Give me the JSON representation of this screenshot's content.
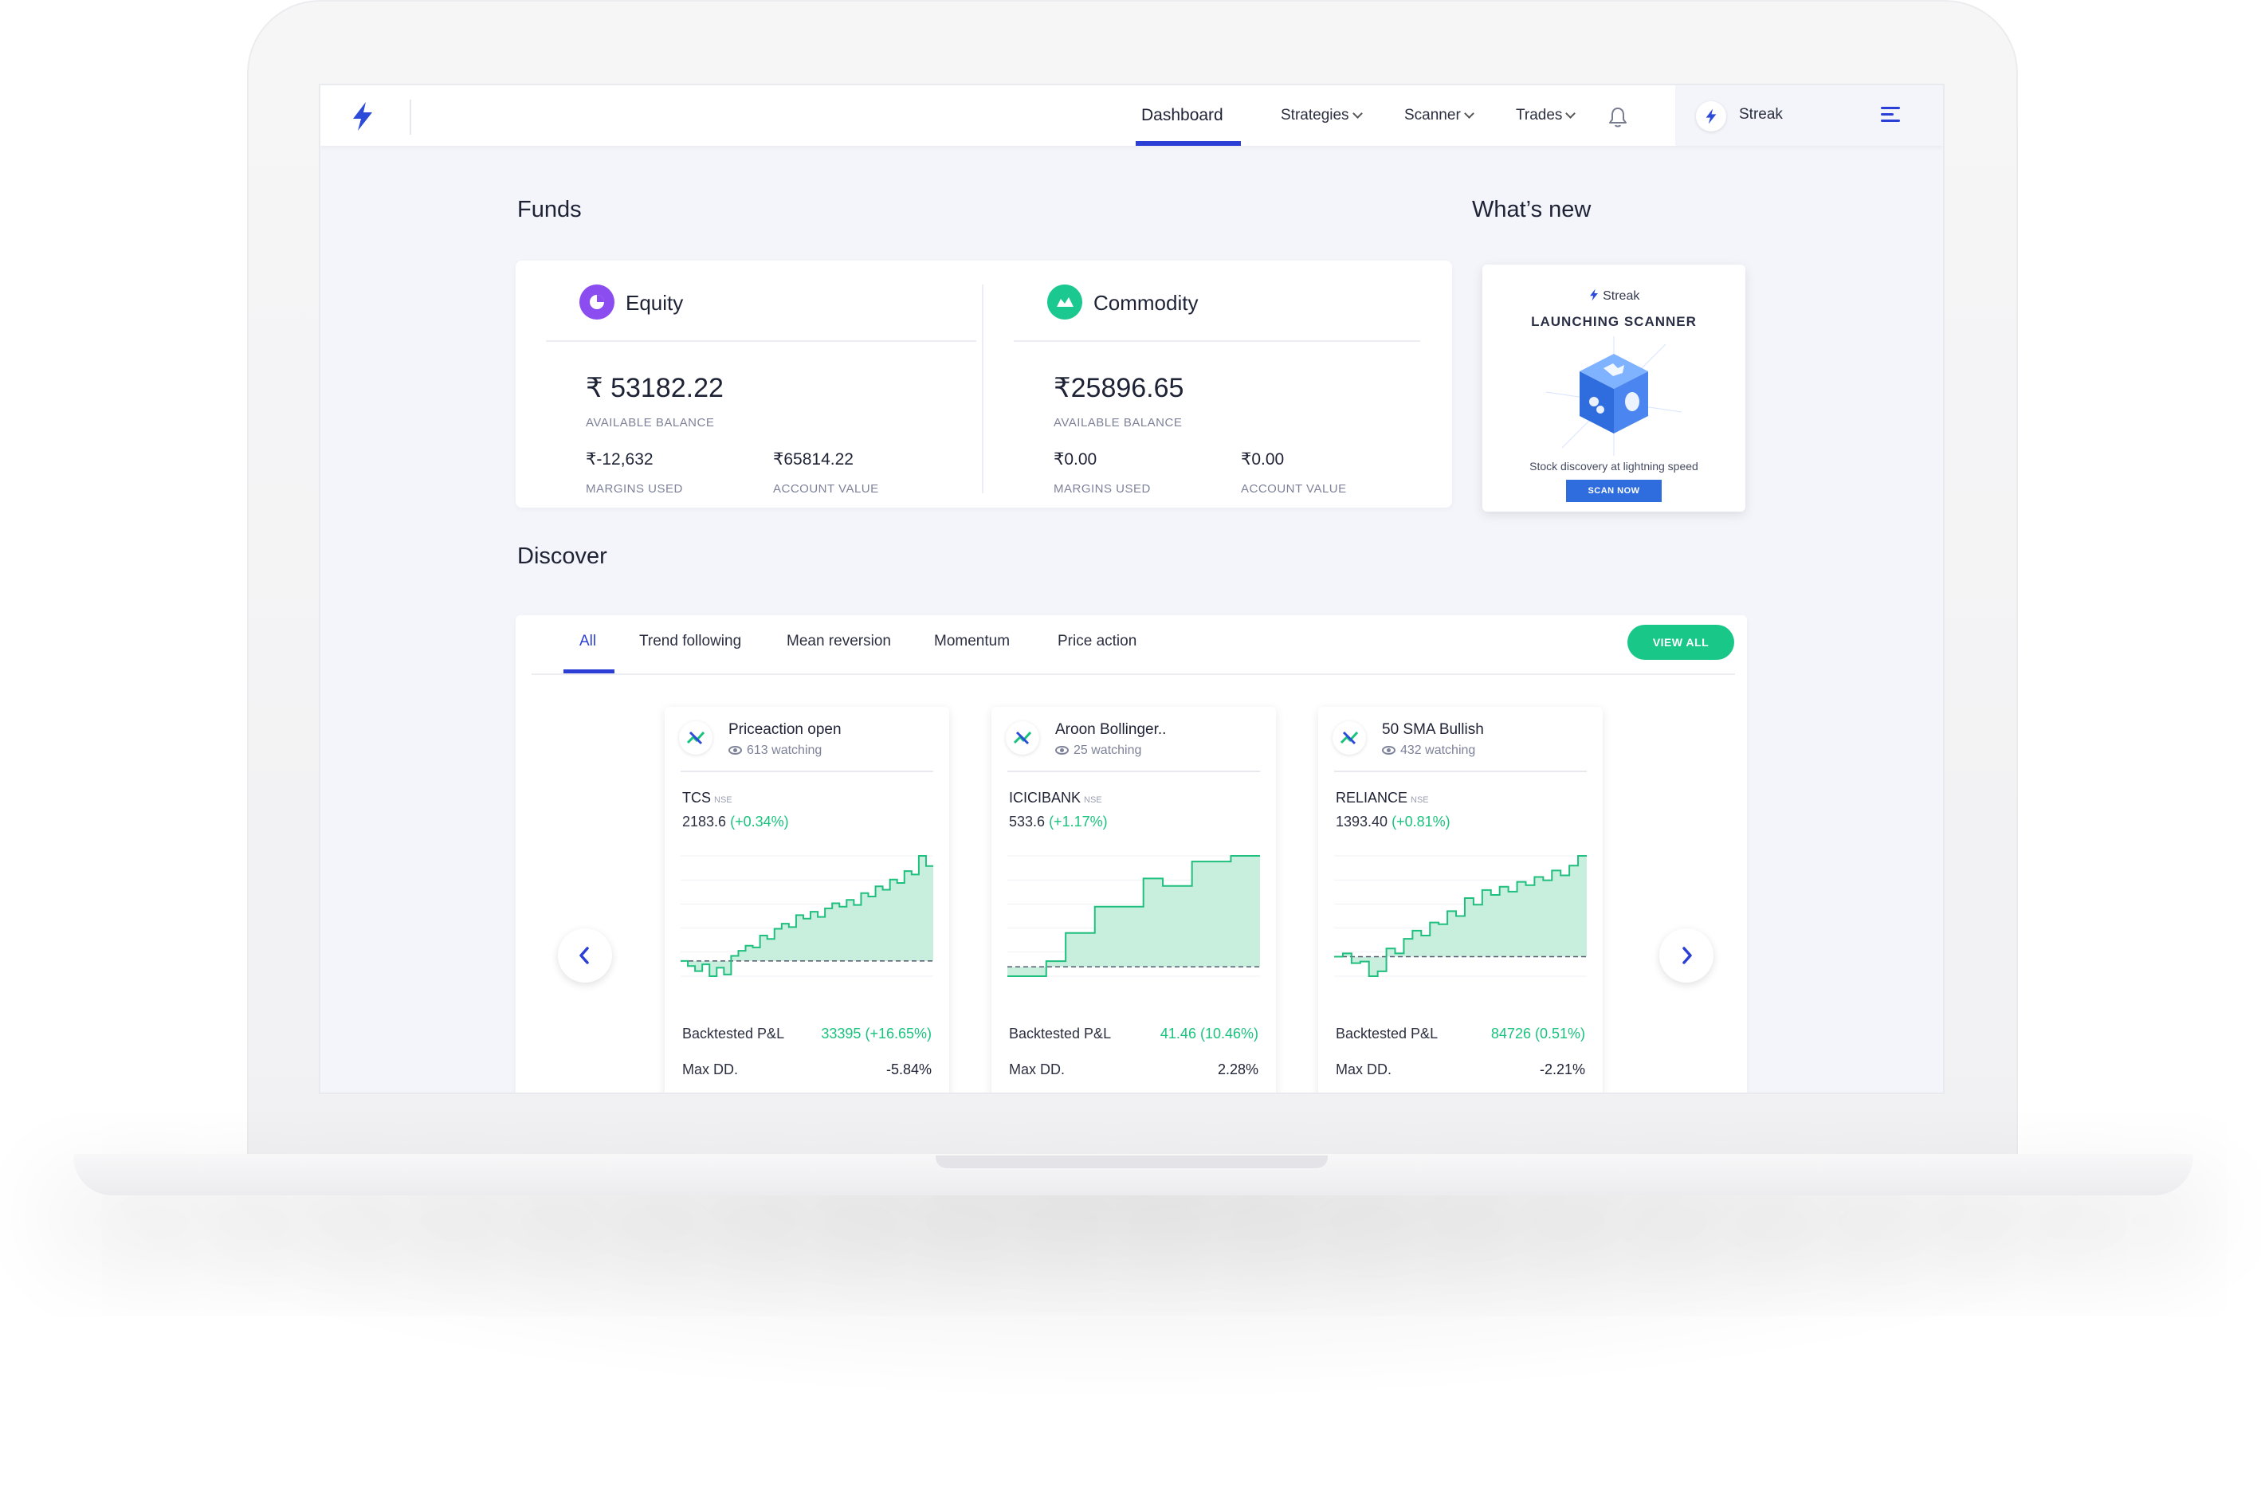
{
  "nav": {
    "items": [
      "Dashboard",
      "Strategies",
      "Scanner",
      "Trades"
    ],
    "account_name": "Streak"
  },
  "funds": {
    "title": "Funds",
    "equity": {
      "label": "Equity",
      "balance": "₹ 53182.22",
      "balance_label": "AVAILABLE BALANCE",
      "margins_used": "₹-12,632",
      "margins_used_label": "MARGINS USED",
      "account_value": "₹65814.22",
      "account_value_label": "ACCOUNT VALUE",
      "color": "#8b4df0"
    },
    "commodity": {
      "label": "Commodity",
      "balance": "₹25896.65",
      "balance_label": "AVAILABLE BALANCE",
      "margins_used": "₹0.00",
      "margins_used_label": "MARGINS USED",
      "account_value": "₹0.00",
      "account_value_label": "ACCOUNT VALUE",
      "color": "#1bc88f"
    }
  },
  "whats_new": {
    "title": "What’s new",
    "brand": "Streak",
    "headline": "LAUNCHING SCANNER",
    "tagline": "Stock discovery at lightning speed",
    "button": "SCAN NOW"
  },
  "discover": {
    "title": "Discover",
    "tabs": [
      "All",
      "Trend following",
      "Mean reversion",
      "Momentum",
      "Price action"
    ],
    "view_all": "VIEW ALL",
    "strategies": [
      {
        "name": "Priceaction open",
        "watching": "613 watching",
        "symbol": "TCS",
        "exchange": "NSE",
        "price": "2183.6",
        "change": "(+0.34%)",
        "pnl_label": "Backtested P&L",
        "pnl": "33395 (+16.65%)",
        "dd_label": "Max DD.",
        "dd": "-5.84%",
        "equity_curve": [
          0,
          -0.3,
          -0.6,
          -0.2,
          -0.9,
          -0.4,
          -0.8,
          0.3,
          0.6,
          0.9,
          0.8,
          1.5,
          1.3,
          1.9,
          2.2,
          2.0,
          2.7,
          2.5,
          2.9,
          2.6,
          3.1,
          3.4,
          3.2,
          3.6,
          3.3,
          4.0,
          3.8,
          4.4,
          4.2,
          4.8,
          4.6,
          5.3,
          5.1,
          6.2,
          5.6
        ]
      },
      {
        "name": "Aroon Bollinger..",
        "watching": "25 watching",
        "symbol": "ICICIBANK",
        "exchange": "NSE",
        "price": "533.6",
        "change": "(+1.17%)",
        "pnl_label": "Backtested P&L",
        "pnl": "41.46 (10.46%)",
        "dd_label": "Max DD.",
        "dd": "2.28%",
        "equity_curve": [
          -0.5,
          -0.5,
          -0.5,
          -0.5,
          0.3,
          0.3,
          1.8,
          1.8,
          1.8,
          3.2,
          3.2,
          3.2,
          3.2,
          3.2,
          4.7,
          4.7,
          4.3,
          4.3,
          4.3,
          5.6,
          5.6,
          5.6,
          5.6,
          5.9,
          5.9,
          5.9
        ]
      },
      {
        "name": "50 SMA Bullish",
        "watching": "432 watching",
        "symbol": "RELIANCE",
        "exchange": "NSE",
        "price": "1393.40",
        "change": "(+0.81%)",
        "pnl_label": "Backtested P&L",
        "pnl": "84726 (0.51%)",
        "dd_label": "Max DD.",
        "dd": "-2.21%",
        "equity_curve": [
          0,
          0.2,
          -0.4,
          -0.3,
          -1.2,
          -0.9,
          0.5,
          0.2,
          1.1,
          1.6,
          1.3,
          2.1,
          2.0,
          2.8,
          2.5,
          3.6,
          3.2,
          4.1,
          3.8,
          4.3,
          4.0,
          4.6,
          4.4,
          4.9,
          4.7,
          5.3,
          5.0,
          5.6,
          6.2
        ]
      }
    ]
  },
  "colors": {
    "accent": "#2b3fd6",
    "green": "#19c37d",
    "chart_fill": "#c8eedd",
    "chart_line": "#1fbf7e"
  }
}
